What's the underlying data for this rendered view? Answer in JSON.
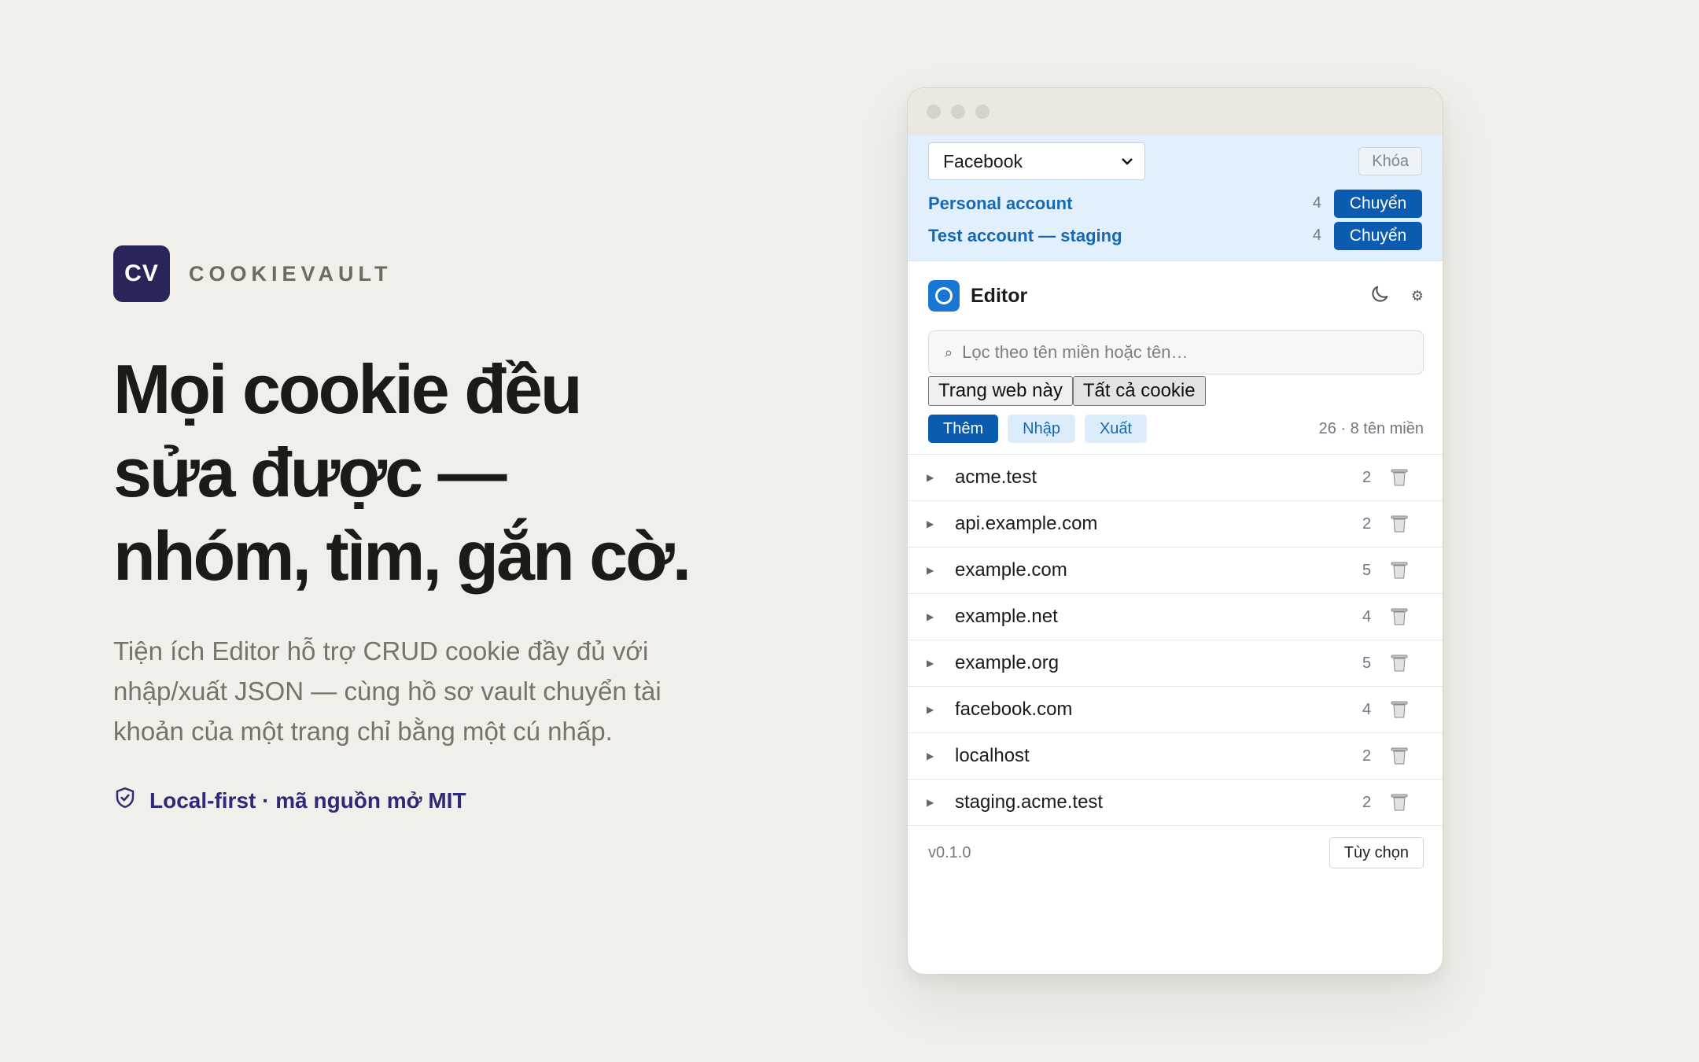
{
  "brand": {
    "logo": "CV",
    "name": "COOKIEVAULT"
  },
  "hero": {
    "headline": [
      "Mọi cookie đều",
      "sửa được —",
      "nhóm, tìm, gắn cờ."
    ],
    "subtitle": "Tiện ích Editor hỗ trợ CRUD cookie đầy đủ với nhập/xuất JSON — cùng hồ sơ vault chuyển tài khoản của một trang chỉ bằng một cú nhấp.",
    "badge": "Local-first · mã nguồn mở MIT",
    "badge_icon": "shield-check-icon"
  },
  "vault": {
    "selected_profile": "Facebook",
    "lock_label": "Khóa",
    "accounts": [
      {
        "name": "Personal account",
        "count": "4",
        "switch_label": "Chuyển"
      },
      {
        "name": "Test account — staging",
        "count": "4",
        "switch_label": "Chuyển"
      }
    ]
  },
  "editor": {
    "title": "Editor",
    "search_placeholder": "Lọc theo tên miền hoặc tên…",
    "scope": [
      "Trang web này",
      "Tất cả cookie"
    ],
    "actions": {
      "add": "Thêm",
      "import": "Nhập",
      "export": "Xuất"
    },
    "summary": "26 · 8 tên miền",
    "domains": [
      {
        "name": "acme.test",
        "count": "2"
      },
      {
        "name": "api.example.com",
        "count": "2"
      },
      {
        "name": "example.com",
        "count": "5"
      },
      {
        "name": "example.net",
        "count": "4"
      },
      {
        "name": "example.org",
        "count": "5"
      },
      {
        "name": "facebook.com",
        "count": "4"
      },
      {
        "name": "localhost",
        "count": "2"
      },
      {
        "name": "staging.acme.test",
        "count": "2"
      }
    ]
  },
  "footer": {
    "version": "v0.1.0",
    "options_label": "Tùy chọn"
  },
  "colors": {
    "background": "#f0efea",
    "brand": "#2a2558",
    "accent": "#0b5cb0",
    "vault_bg": "#e2f0fd"
  }
}
